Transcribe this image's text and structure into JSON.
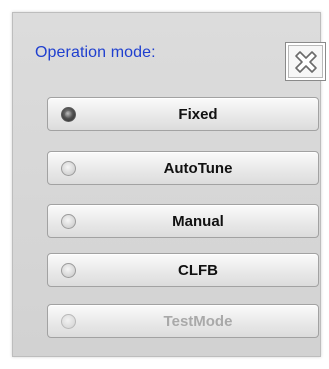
{
  "dialog": {
    "title": "Operation mode:",
    "close_icon": "close-icon",
    "modes": [
      {
        "label": "Fixed",
        "selected": true,
        "enabled": true
      },
      {
        "label": "AutoTune",
        "selected": false,
        "enabled": true
      },
      {
        "label": "Manual",
        "selected": false,
        "enabled": true
      },
      {
        "label": "CLFB",
        "selected": false,
        "enabled": true
      },
      {
        "label": "TestMode",
        "selected": false,
        "enabled": false
      }
    ]
  },
  "colors": {
    "title": "#1f3fcf",
    "dialog_bg": "#d6d6d6",
    "disabled_text": "#a9a9a9"
  }
}
